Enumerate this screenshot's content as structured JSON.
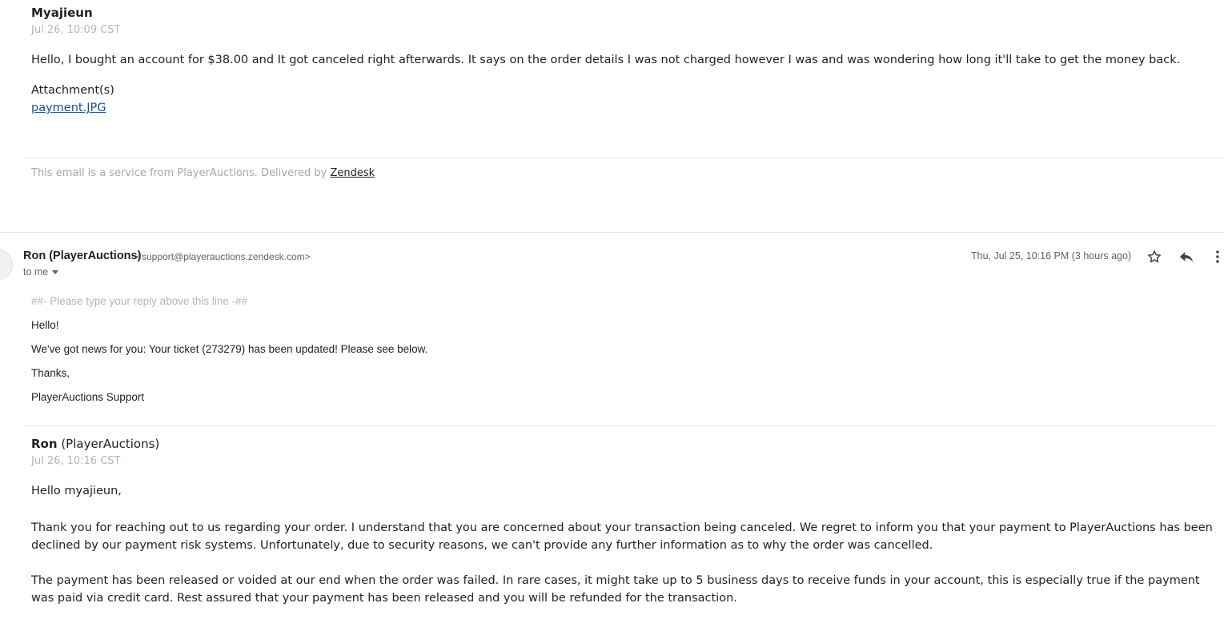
{
  "message1": {
    "author": "Myajieun",
    "date": "Jul 26, 10:09 CST",
    "body": "Hello, I bought an account for $38.00 and It got canceled right afterwards. It says on the order details I was not charged however I was and was wondering how long it'll take to get the money back.",
    "attachments_label": "Attachment(s)",
    "attachment_link": "payment.JPG"
  },
  "footer": {
    "text": "This email is a service from PlayerAuctions. Delivered by",
    "link": "Zendesk"
  },
  "email_header": {
    "sender_name": "Ron (PlayerAuctions)",
    "sender_email": "<support@playerauctions.zendesk.com>",
    "to_label": "to me",
    "timestamp": "Thu, Jul 25, 10:16 PM (3 hours ago)",
    "icons": [
      "star-icon",
      "reply-icon",
      "more-vert-icon"
    ]
  },
  "email_body": {
    "reply_line": "##- Please type your reply above this line -##",
    "greeting": "Hello!",
    "news": "We've got news for you: Your ticket (273279) has been updated! Please see below.",
    "thanks": "Thanks,",
    "signature": "PlayerAuctions Support"
  },
  "message2": {
    "author_first": "Ron",
    "author_rest": "(PlayerAuctions)",
    "date": "Jul 26, 10:16 CST",
    "greeting": "Hello myajieun,",
    "paragraph1": "Thank you for reaching out to us regarding your order. I understand that you are concerned about your transaction being canceled. We regret to inform you that your payment to PlayerAuctions has been declined by our payment risk systems. Unfortunately, due to security reasons, we can't provide any further information as to why the order was cancelled.",
    "paragraph2": "The payment has been released or voided at our end when the order was failed. In rare cases, it might take up to 5 business days to receive funds in your account, this is especially true if the payment was paid via credit card. Rest assured that your payment has been released and you will be refunded for the transaction."
  }
}
